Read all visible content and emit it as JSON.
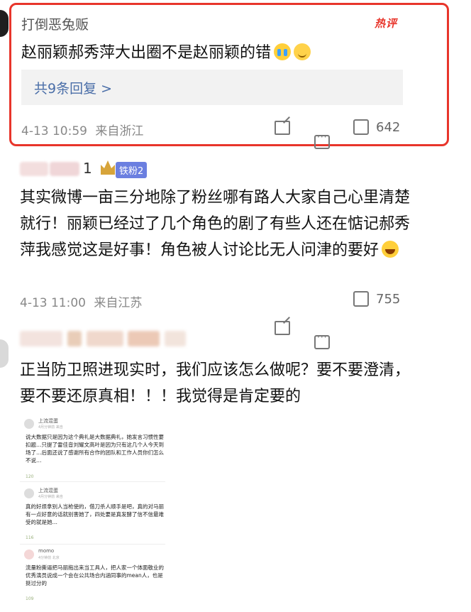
{
  "comment1": {
    "username": "打倒恶兔贩",
    "hot_badge": "热评",
    "text": "赵丽颖郝秀萍大出圈不是赵丽颖的错",
    "replies_label": "共9条回复 >",
    "timestamp": "4-13 10:59",
    "location": "来自浙江",
    "likes": "642"
  },
  "comment2": {
    "username_tail": "1",
    "fan_badge": "铁粉2",
    "text": "其实微博一亩三分地除了粉丝哪有路人大家自己心里清楚就行！丽颖已经过了几个角色的剧了有些人还在惦记郝秀萍我感觉这是好事！角色被人讨论比无人问津的要好",
    "timestamp": "4-13 11:00",
    "location": "来自江苏",
    "likes": "755"
  },
  "comment3": {
    "text": "正当防卫照进现实时，我们应该怎么做呢？要不要澄清，要不要还原真相！！！我觉得是肯定要的"
  },
  "embedded": {
    "items": [
      {
        "user": "上流混蛋",
        "sub": "4月分钟前 来自",
        "text": "说大数据只是因为这个典礼是大数据典礼，她发言习惯性要扣题…只提了雷佳音刘耀文高叶是因为只有这几个人今天到场了…后面还说了感谢所有合作的团队和工作人员你们怎么不说…",
        "likes": "120"
      },
      {
        "user": "上流混蛋",
        "sub": "4月分钟前 来自",
        "text": "真的好烦拿别人当枪使的，借刀杀人顺手是吧，真的对马丽有一点好意的话就别害她了，四处要是真发酵了信不信最难受的就是她…",
        "likes": "116"
      },
      {
        "user": "momo",
        "sub": "4分钟前 北京",
        "text": "流量粉撕逼把马丽拖出来当工具人，把人家一个体面敬业的优秀演员说成一个会在公共场合内涵同事的mean人，也是挺过分的",
        "likes": "109"
      }
    ]
  },
  "colors": {
    "highlight_border": "#e8352b",
    "reply_link": "#4a6ea8",
    "fan_badge": "#6b7fe0"
  }
}
